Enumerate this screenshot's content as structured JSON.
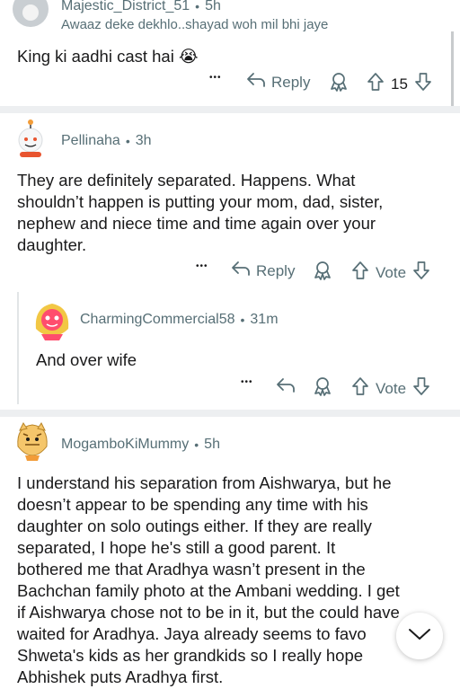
{
  "comments": [
    {
      "username": "Majestic_District_51",
      "time": "5h",
      "flair": "Awaaz deke dekhlo..shayad woh mil bhi jaye",
      "text": "King ki aadhi cast hai 😭",
      "reply_label": "Reply",
      "votes": "15"
    },
    {
      "username": "Pellinaha",
      "time": "3h",
      "text_lines": [
        "They are definitely separated. Happens. What",
        "shouldn’t happen is putting your mom, dad, sister,",
        "nephew and niece time and time again over your",
        "daughter."
      ],
      "reply_label": "Reply",
      "votes": "Vote"
    },
    {
      "username": "CharmingCommercial58",
      "time": "31m",
      "text": "And over wife",
      "votes": "Vote"
    },
    {
      "username": "MogamboKiMummy",
      "time": "5h",
      "text_lines": [
        "I understand his separation from Aishwarya, but he",
        "doesn’t appear to be spending any time with his",
        "daughter on solo outings either. If they are really",
        "separated, I hope he's still a good parent. It",
        "bothered me that Aradhya wasn’t present in the",
        "Bachchan family photo at the Ambani wedding. I get",
        "if Aishwarya chose not to be in it, but the could have",
        "waited for Aradhya. Jaya already seems to favo",
        "Shweta's kids as her grandkids so I really hope",
        "Abhishek puts Aradhya first."
      ]
    }
  ],
  "separator": "•",
  "more_label": "•••",
  "icons": [
    "more-icon",
    "reply-icon",
    "award-icon",
    "upvote-icon",
    "downvote-icon",
    "chevron-down-icon"
  ]
}
